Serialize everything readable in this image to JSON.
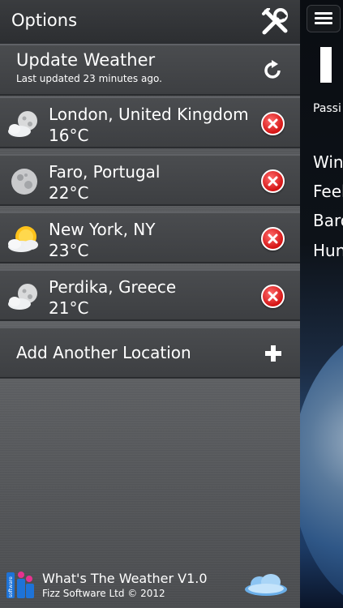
{
  "header": {
    "title": "Options"
  },
  "update": {
    "title": "Update Weather",
    "subtitle": "Last updated 23 minutes ago."
  },
  "locations": [
    {
      "name": "London, United Kingdom",
      "temp": "16°C",
      "icon": "moon-cloud-icon"
    },
    {
      "name": "Faro, Portugal",
      "temp": "22°C",
      "icon": "moon-icon"
    },
    {
      "name": "New York, NY",
      "temp": "23°C",
      "icon": "sun-cloud-icon"
    },
    {
      "name": "Perdika, Greece",
      "temp": "21°C",
      "icon": "moon-cloud-icon"
    }
  ],
  "add_location": {
    "label": "Add Another Location"
  },
  "footer": {
    "app_title": "What's The Weather V1.0",
    "copyright": "Fizz Software Ltd © 2012",
    "logo_text": "software"
  },
  "main": {
    "big_text": "I",
    "condition": "Passi",
    "details": [
      "Win",
      "Feel",
      "Baro",
      "Hun"
    ]
  },
  "colors": {
    "delete_button": "#d41414",
    "panel_bg": "#55575a"
  }
}
